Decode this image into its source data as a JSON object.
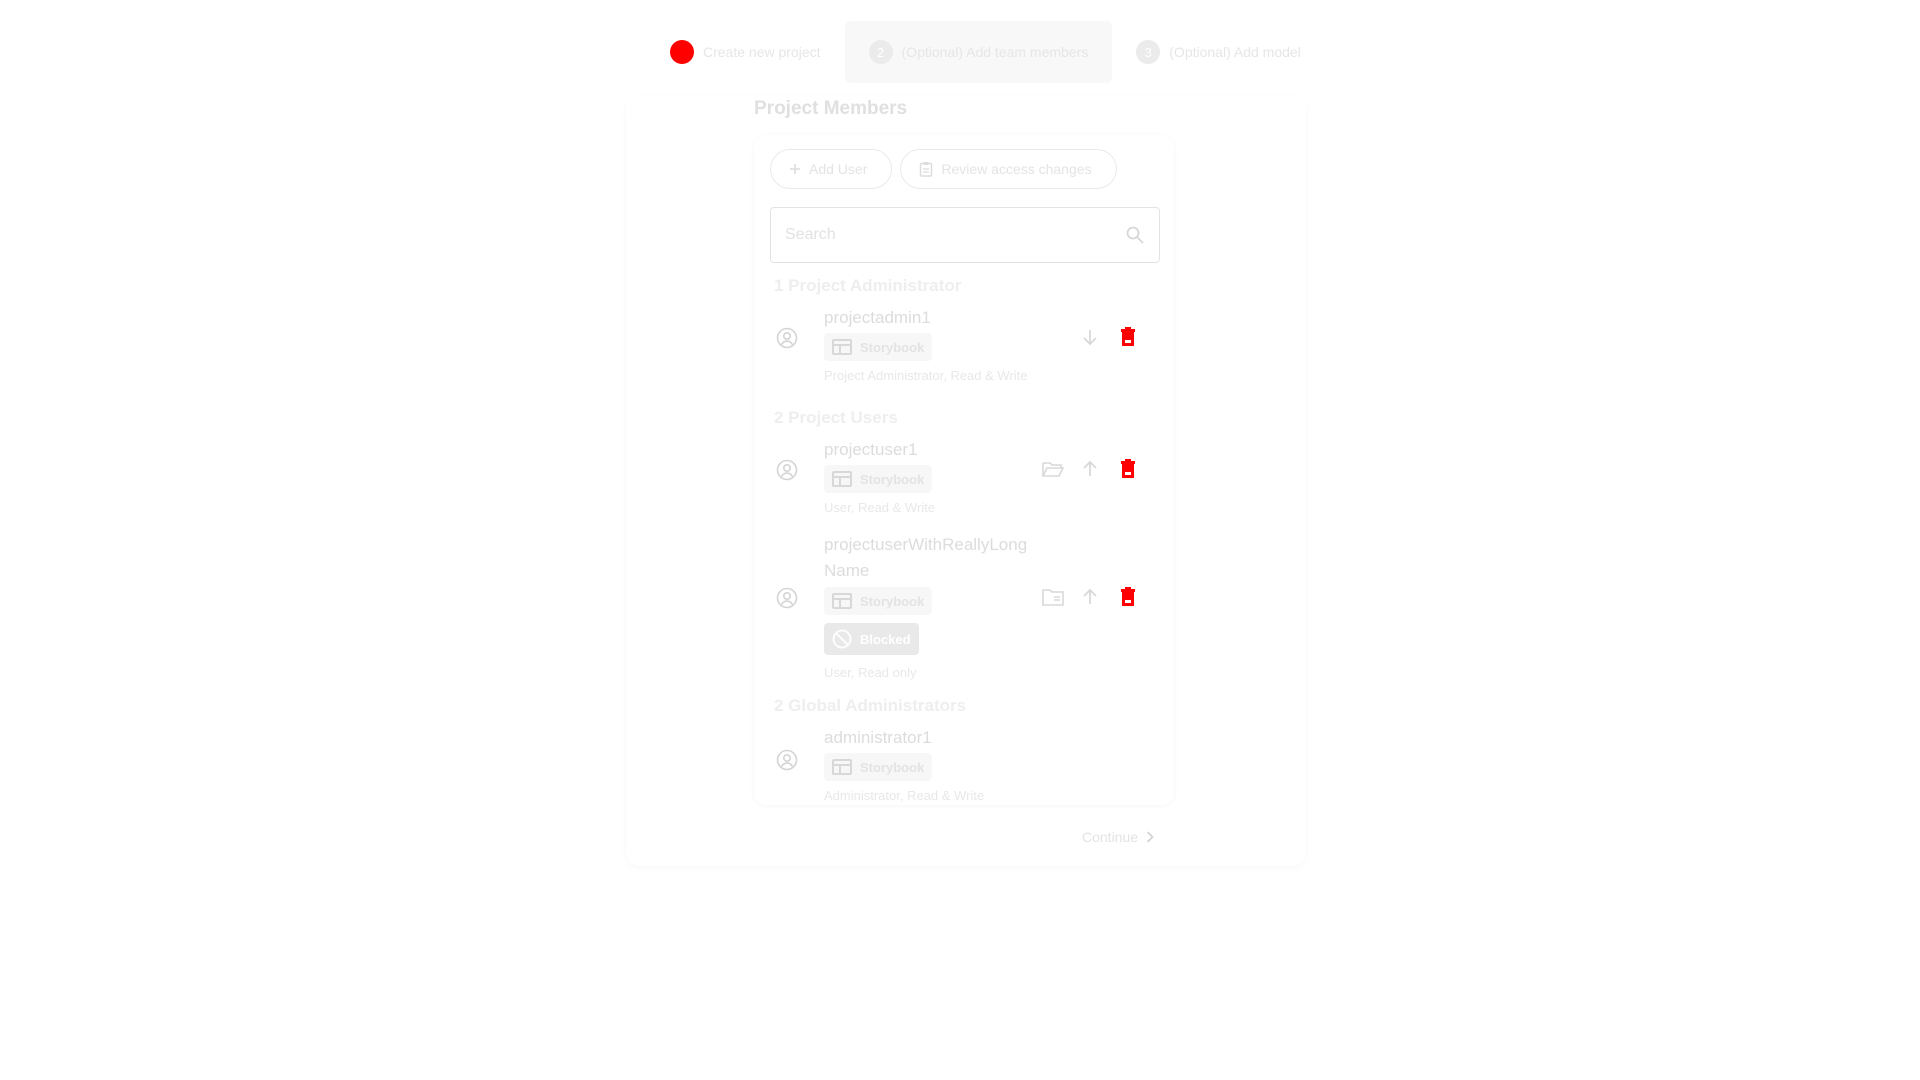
{
  "stepper": {
    "steps": [
      {
        "number": "",
        "label": "Create new project",
        "state": "done"
      },
      {
        "number": "2",
        "label": "(Optional) Add team members",
        "state": "active"
      },
      {
        "number": "3",
        "label": "(Optional) Add model",
        "state": "pending"
      }
    ]
  },
  "section": {
    "title": "Project Members"
  },
  "actions": {
    "add_user": "Add User",
    "review_access": "Review access changes"
  },
  "search": {
    "placeholder": "Search"
  },
  "groups": [
    {
      "title": "1 Project Administrator",
      "members": [
        {
          "name": "projectadmin1",
          "badge": "Storybook",
          "role": "Project Administrator, Read & Write",
          "actions": [
            "arrow-down-icon",
            "delete-icon"
          ]
        }
      ]
    },
    {
      "title": "2 Project Users",
      "members": [
        {
          "name": "projectuser1",
          "badge": "Storybook",
          "role": "User, Read & Write",
          "actions": [
            "folder-open-icon",
            "arrow-up-icon",
            "delete-icon"
          ]
        },
        {
          "name": "projectuserWithReallyLongName",
          "badge": "Storybook",
          "status": "Blocked",
          "role": "User, Read only",
          "actions": [
            "folder-list-icon",
            "arrow-up-icon",
            "delete-icon"
          ]
        }
      ]
    },
    {
      "title": "2 Global Administrators",
      "members": [
        {
          "name": "administrator1",
          "badge": "Storybook",
          "role": "Administrator, Read & Write"
        }
      ]
    }
  ],
  "footer": {
    "continue_label": "Continue"
  },
  "colors": {
    "accent": "#ff0000",
    "delete": "#ff0000",
    "muted": "#e3e3e3"
  }
}
